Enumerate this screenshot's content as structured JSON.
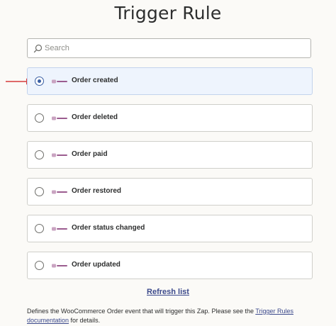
{
  "page": {
    "title": "Trigger Rule"
  },
  "search": {
    "placeholder": "Search",
    "value": "",
    "icon": "search-icon"
  },
  "options": [
    {
      "label": "Order created",
      "selected": true
    },
    {
      "label": "Order deleted",
      "selected": false
    },
    {
      "label": "Order paid",
      "selected": false
    },
    {
      "label": "Order restored",
      "selected": false
    },
    {
      "label": "Order status changed",
      "selected": false
    },
    {
      "label": "Order updated",
      "selected": false
    }
  ],
  "refresh": {
    "label": "Refresh list"
  },
  "help": {
    "text_before": "Defines the WooCommerce Order event that will trigger this Zap. Please see the ",
    "link_part1": "Trigger Rules",
    "link_part2": "documentation",
    "text_after": " for details."
  },
  "colors": {
    "accent": "#3a5fa3",
    "link": "#3c4a8c",
    "selected_bg": "#eef4fd",
    "arrow": "#d63b3b",
    "logo": "#9b5c8f"
  }
}
